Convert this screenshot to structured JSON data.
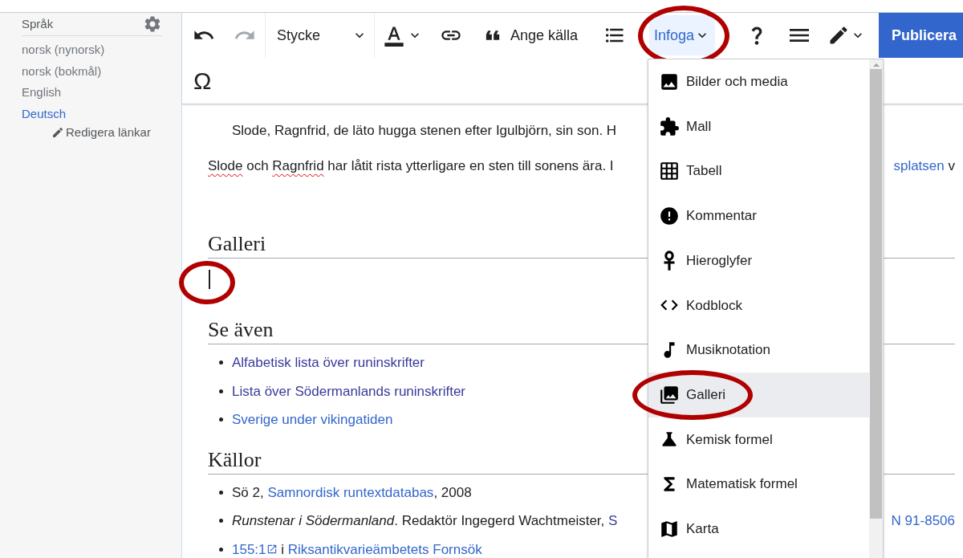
{
  "sidebar": {
    "title": "Språk",
    "languages": [
      {
        "label": "norsk (nynorsk)",
        "kind": "missing"
      },
      {
        "label": "norsk (bokmål)",
        "kind": "missing"
      },
      {
        "label": "English",
        "kind": "missing"
      },
      {
        "label": "Deutsch",
        "kind": "link"
      }
    ],
    "edit_links": "Redigera länkar"
  },
  "toolbar": {
    "row1": [
      {
        "kind": "undo",
        "disabled": false
      },
      {
        "kind": "redo",
        "disabled": true
      },
      {
        "kind": "format",
        "label": "Stycke"
      },
      {
        "kind": "text_style"
      },
      {
        "kind": "link"
      },
      {
        "kind": "cite",
        "label": "Ange källa"
      },
      {
        "kind": "list"
      },
      {
        "kind": "insert",
        "label": "Infoga",
        "expanded": true,
        "annotated": true
      },
      {
        "kind": "help"
      },
      {
        "kind": "menu"
      },
      {
        "kind": "edit_mode"
      },
      {
        "kind": "publish",
        "label": "Publicera"
      }
    ],
    "row2": [
      {
        "kind": "special_characters",
        "label": "Ω"
      }
    ]
  },
  "content": {
    "paragraphs": [
      {
        "kind": "block_quote",
        "segments": [
          {
            "kind": "plain",
            "text": "Slode, Ragnfrid, de läto hugga stenen efter Igulbjörn, sin son. H"
          }
        ]
      },
      {
        "kind": "paragraph",
        "segments": [
          {
            "kind": "misspelled",
            "text": "Slode"
          },
          {
            "kind": "plain",
            "text": " och "
          },
          {
            "kind": "misspelled",
            "text": "Ragnfrid"
          },
          {
            "kind": "plain",
            "text": " har låtit rista ytterligare en sten till sonens ära. I"
          }
        ],
        "right_segments": [
          {
            "kind": "link",
            "text": "splatsen"
          },
          {
            "kind": "plain",
            "text": " v"
          }
        ]
      }
    ],
    "sections": [
      {
        "heading": "Galleri",
        "cursor": true,
        "annotated": true
      },
      {
        "heading": "Se även",
        "cursor": false,
        "annotated": false,
        "items": [
          {
            "segments": [
              {
                "kind": "visited",
                "text": "Alfabetisk lista över runinskrifter"
              }
            ]
          },
          {
            "segments": [
              {
                "kind": "visited",
                "text": "Lista över Södermanlands runinskrifter"
              }
            ]
          },
          {
            "segments": [
              {
                "kind": "link",
                "text": "Sverige under vikingatiden"
              }
            ]
          }
        ]
      },
      {
        "heading": "Källor",
        "cursor": false,
        "annotated": false,
        "items": [
          {
            "segments": [
              {
                "kind": "plain",
                "text": "Sö 2, "
              },
              {
                "kind": "link",
                "text": "Samnordisk runtextdatabas"
              },
              {
                "kind": "plain",
                "text": ", 2008"
              }
            ]
          },
          {
            "segments": [
              {
                "kind": "italic",
                "text": "Runstenar i Södermanland"
              },
              {
                "kind": "plain",
                "text": ". Redaktör Ingegerd Wachtmeister, "
              },
              {
                "kind": "visited",
                "text": "S"
              }
            ],
            "right_segments": [
              {
                "kind": "link",
                "text": "N 91-8506"
              }
            ]
          },
          {
            "segments": [
              {
                "kind": "external",
                "text": "155:1"
              },
              {
                "kind": "plain",
                "text": " i "
              },
              {
                "kind": "link",
                "text": "Riksantikvarieämbetets"
              },
              {
                "kind": "misspelled_link",
                "text": "Fornsök"
              }
            ]
          }
        ]
      }
    ]
  },
  "insert_menu": {
    "items": [
      {
        "label": "Bilder och media",
        "selected": false,
        "annotated": false
      },
      {
        "label": "Mall",
        "selected": false,
        "annotated": false
      },
      {
        "label": "Tabell",
        "selected": false,
        "annotated": false
      },
      {
        "label": "Kommentar",
        "selected": false,
        "annotated": false
      },
      {
        "label": "Hieroglyfer",
        "selected": false,
        "annotated": false
      },
      {
        "label": "Kodblock",
        "selected": false,
        "annotated": false
      },
      {
        "label": "Musiknotation",
        "selected": false,
        "annotated": false
      },
      {
        "label": "Galleri",
        "selected": true,
        "annotated": true
      },
      {
        "label": "Kemisk formel",
        "selected": false,
        "annotated": false
      },
      {
        "label": "Matematisk formel",
        "selected": false,
        "annotated": false
      },
      {
        "label": "Karta",
        "selected": false,
        "annotated": false
      }
    ]
  }
}
